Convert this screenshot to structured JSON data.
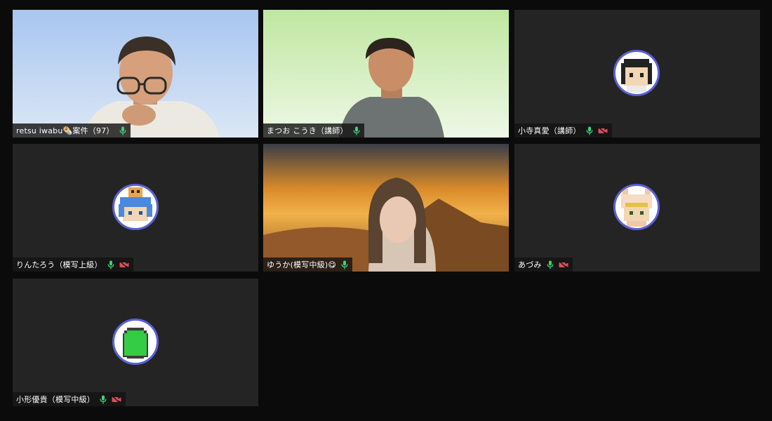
{
  "participants": [
    {
      "name": "retsu iwabu🌯案件（97）",
      "video": true,
      "mic_on": true,
      "cam_off_indicator": false
    },
    {
      "name": "まつお こうき（講師）",
      "video": true,
      "mic_on": true,
      "cam_off_indicator": false
    },
    {
      "name": "小寺真愛（講師）",
      "video": false,
      "mic_on": true,
      "cam_off_indicator": true
    },
    {
      "name": "りんたろう（模写上級）",
      "video": false,
      "mic_on": true,
      "cam_off_indicator": true
    },
    {
      "name": "ゆうか(模写中級)😋",
      "video": true,
      "mic_on": true,
      "cam_off_indicator": false
    },
    {
      "name": "あづみ",
      "video": false,
      "mic_on": true,
      "cam_off_indicator": true
    },
    {
      "name": "小形優貴（模写中級）",
      "video": false,
      "mic_on": true,
      "cam_off_indicator": true
    }
  ],
  "icons": {
    "mic": "microphone-icon",
    "camera_off": "camera-off-icon"
  },
  "colors": {
    "mic_green": "#3fd07a",
    "cam_off_red": "#e54b5b",
    "avatar_ring": "#5b61d6",
    "tile_bg": "#242424",
    "page_bg": "#0b0b0b"
  }
}
